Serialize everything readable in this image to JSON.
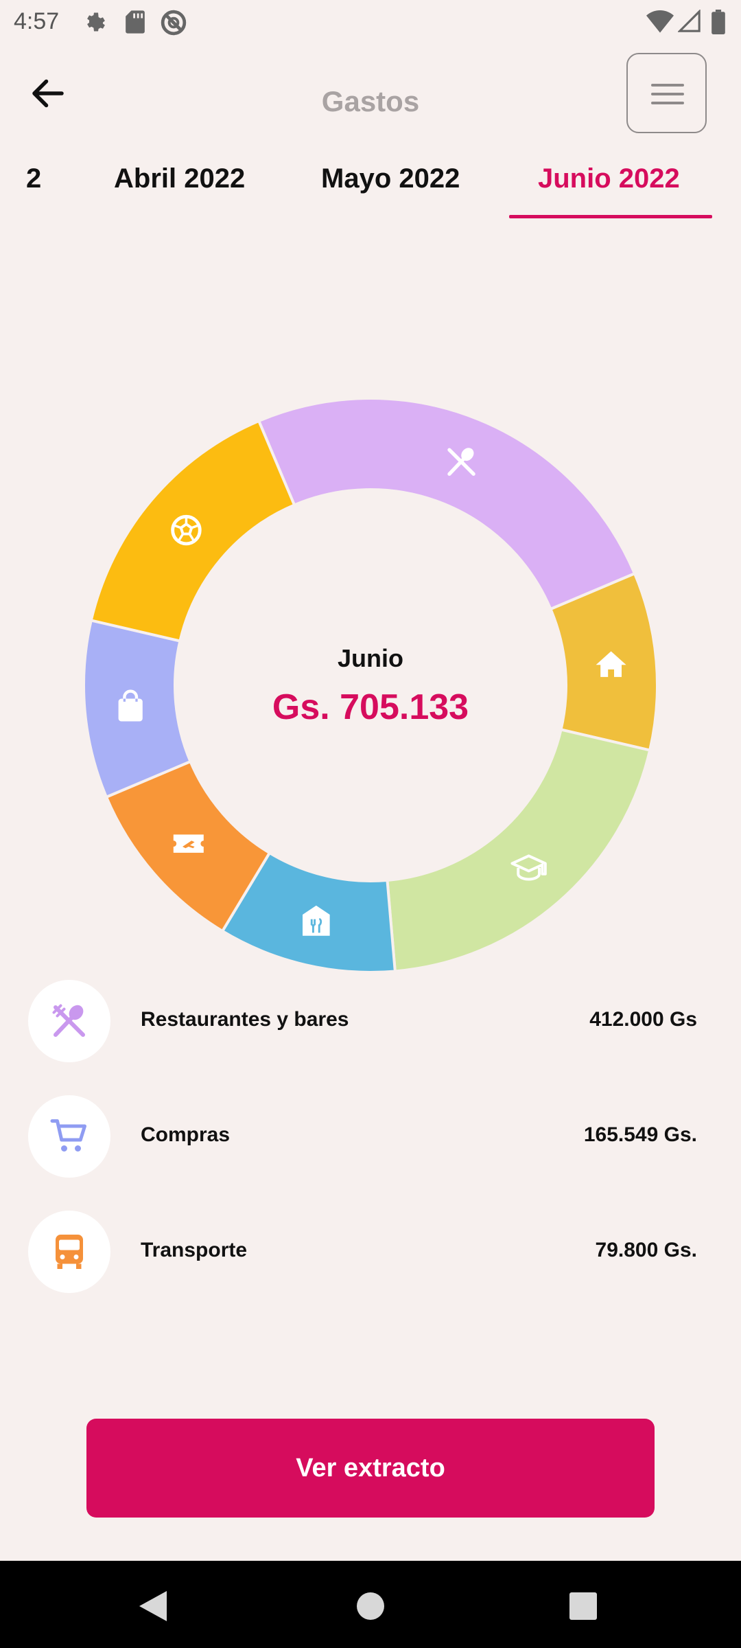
{
  "status_bar": {
    "time": "4:57"
  },
  "header": {
    "title": "Gastos"
  },
  "tabs": [
    {
      "label": "2"
    },
    {
      "label": "Abril 2022"
    },
    {
      "label": "Mayo 2022"
    },
    {
      "label": "Junio 2022",
      "active": true
    }
  ],
  "summary": {
    "month": "Junio",
    "total": "Gs. 705.133"
  },
  "chart_data": {
    "type": "pie",
    "title": "",
    "segments": [
      {
        "icon": "fork-spoon-icon",
        "color": "#dab0f5",
        "share": 0.25
      },
      {
        "icon": "home-icon",
        "color": "#f0bf3c",
        "share": 0.1
      },
      {
        "icon": "graduation-cap-icon",
        "color": "#d0e6a2",
        "share": 0.2
      },
      {
        "icon": "restaurant-icon",
        "color": "#5ab6de",
        "share": 0.1
      },
      {
        "icon": "ticket-icon",
        "color": "#f89638",
        "share": 0.1
      },
      {
        "icon": "shopping-bag-icon",
        "color": "#a8b0f6",
        "share": 0.1
      },
      {
        "icon": "soccer-ball-icon",
        "color": "#fcbc11",
        "share": 0.15
      }
    ]
  },
  "categories": [
    {
      "name": "Restaurantes y bares",
      "amount": "412.000 Gs",
      "icon": "fork-spoon-icon",
      "color": "#c998ee"
    },
    {
      "name": "Compras",
      "amount": "165.549 Gs.",
      "icon": "cart-icon",
      "color": "#8f9cf2"
    },
    {
      "name": "Transporte",
      "amount": "79.800 Gs.",
      "icon": "bus-icon",
      "color": "#f5913a"
    }
  ],
  "actions": {
    "statement_button": "Ver extracto"
  },
  "colors": {
    "accent": "#d60c5d",
    "background": "#f7f0ee"
  }
}
